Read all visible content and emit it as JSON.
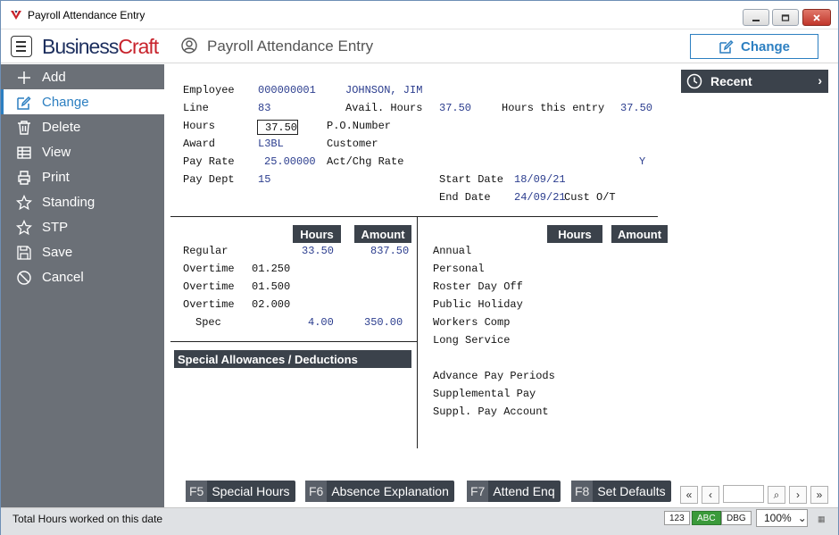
{
  "window": {
    "title": "Payroll Attendance Entry",
    "minimize_glyph": "▁",
    "maximize_glyph": "▢",
    "close_glyph": "✕"
  },
  "header": {
    "brand_part1": "Business",
    "brand_part2": "Craft",
    "page_title": "Payroll Attendance Entry",
    "mode_button_label": "Change",
    "brand_colors": {
      "navy": "#1d2f5e",
      "red": "#c8232c",
      "accent": "#2c7fc1"
    }
  },
  "sidebar": {
    "items": [
      {
        "label": "Add",
        "icon": "plus-icon",
        "active": false
      },
      {
        "label": "Change",
        "icon": "edit-icon",
        "active": true
      },
      {
        "label": "Delete",
        "icon": "trash-icon",
        "active": false
      },
      {
        "label": "View",
        "icon": "table-icon",
        "active": false
      },
      {
        "label": "Print",
        "icon": "printer-icon",
        "active": false
      },
      {
        "label": "Standing",
        "icon": "star-icon",
        "active": false
      },
      {
        "label": "STP",
        "icon": "star-icon",
        "active": false
      },
      {
        "label": "Save",
        "icon": "save-icon",
        "active": false
      },
      {
        "label": "Cancel",
        "icon": "cancel-icon",
        "active": false
      }
    ]
  },
  "form": {
    "employee_label": "Employee",
    "employee_number": "000000001",
    "employee_name": "JOHNSON, JIM",
    "line_label": "Line",
    "line_value": "83",
    "avail_hours_label": "Avail. Hours",
    "avail_hours_value": "37.50",
    "hours_this_entry_label": "Hours this entry",
    "hours_this_entry_value": "37.50",
    "hours_label": "Hours",
    "hours_value": "37.50",
    "po_number_label": "P.O.Number",
    "award_label": "Award",
    "award_value": "L3BL",
    "customer_label": "Customer",
    "pay_rate_label": "Pay Rate",
    "pay_rate_value": "25.00000",
    "act_chg_rate_label": "Act/Chg Rate",
    "act_chg_rate_flag": "Y",
    "pay_dept_label": "Pay Dept",
    "pay_dept_value": "15",
    "start_date_label": "Start Date",
    "start_date_value": "18/09/21",
    "end_date_label": "End Date",
    "end_date_value": "24/09/21",
    "cust_ot_label": "Cust O/T"
  },
  "left_grid": {
    "hours_header": "Hours",
    "amount_header": "Amount",
    "rows": [
      {
        "label": "Regular",
        "factor": "",
        "hours": "33.50",
        "amount": "837.50"
      },
      {
        "label": "Overtime",
        "factor": "01.250",
        "hours": "",
        "amount": ""
      },
      {
        "label": "Overtime",
        "factor": "01.500",
        "hours": "",
        "amount": ""
      },
      {
        "label": "Overtime",
        "factor": "02.000",
        "hours": "",
        "amount": ""
      },
      {
        "label": "Spec",
        "factor": "",
        "hours": "4.00",
        "amount": "350.00"
      }
    ],
    "special_section_title": "Special Allowances / Deductions"
  },
  "right_grid": {
    "hours_header": "Hours",
    "amount_header": "Amount",
    "rows": [
      "Annual",
      "Personal",
      "Roster Day Off",
      "Public Holiday",
      "Workers Comp",
      "Long Service",
      "",
      "Advance Pay Periods",
      "Supplemental Pay",
      "Suppl. Pay Account"
    ]
  },
  "recent": {
    "label": "Recent",
    "chevron": "›"
  },
  "function_keys": [
    {
      "key": "F5",
      "label": "Special Hours"
    },
    {
      "key": "F6",
      "label": "Absence Explanation"
    },
    {
      "key": "F7",
      "label": "Attend Enq"
    },
    {
      "key": "F8",
      "label": "Set Defaults"
    }
  ],
  "nav": {
    "first": "«",
    "prev": "‹",
    "search": "⌕",
    "next": "›",
    "last": "»"
  },
  "statusbar": {
    "message": "Total Hours worked on this date",
    "badge_num": "123",
    "badge_abc": "ABC",
    "badge_dbg": "DBG",
    "zoom": "100%",
    "zoom_chevron": "⌄",
    "grip": "▦"
  }
}
